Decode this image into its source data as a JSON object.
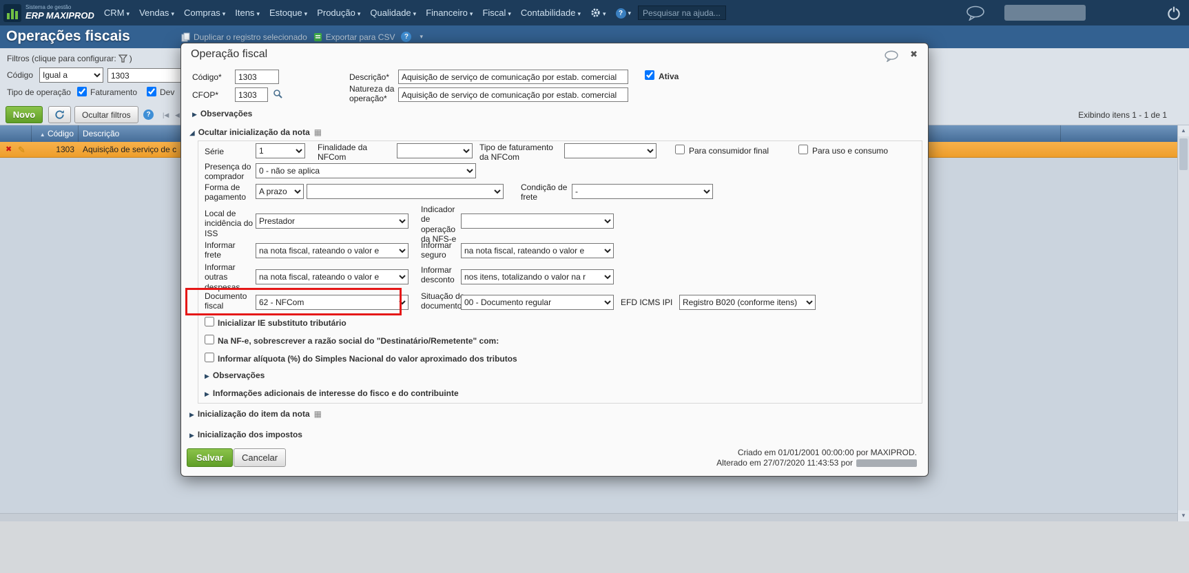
{
  "icons": {
    "caret_down": "▾",
    "collapsed": "▶",
    "expanded": "◢",
    "grid": "▦",
    "close": "✖",
    "delete": "✖",
    "edit": "✎",
    "sort_asc": "▲",
    "scroll_up": "▲",
    "scroll_down": "▼",
    "help": "?",
    "page_first": "|◀",
    "page_prev": "◀"
  },
  "topbar": {
    "brand_top": "Sistema de gestão",
    "brand_main": "ERP MAXIPROD",
    "menus": [
      "CRM",
      "Vendas",
      "Compras",
      "Itens",
      "Estoque",
      "Produção",
      "Qualidade",
      "Financeiro",
      "Fiscal",
      "Contabilidade"
    ],
    "search_placeholder": "Pesquisar na ajuda..."
  },
  "page": {
    "title": "Operações fiscais",
    "toolbar": {
      "duplicate": "Duplicar o registro selecionado",
      "export_csv": "Exportar para CSV"
    },
    "filters": {
      "header": "Filtros (clique para configurar:",
      "header_close": ")",
      "codigo_label": "Código",
      "codigo_operator": "Igual a",
      "codigo_value": "1303",
      "tipo_operacao_label": "Tipo de operação",
      "faturamento_label": "Faturamento",
      "faturamento_checked": true,
      "devolucao_label": "Dev",
      "devolucao_checked": true
    },
    "buttons": {
      "novo": "Novo",
      "ocultar_filtros": "Ocultar filtros"
    },
    "paging_status": "Exibindo itens 1 - 1 de 1",
    "grid": {
      "columns": [
        "Código",
        "Descrição"
      ],
      "rows": [
        {
          "codigo": "1303",
          "descricao": "Aquisição de serviço de c"
        }
      ]
    }
  },
  "modal": {
    "title": "Operação fiscal",
    "codigo": {
      "label": "Código*",
      "value": "1303"
    },
    "descricao": {
      "label": "Descrição*",
      "value": "Aquisição de serviço de comunicação por estab. comercial"
    },
    "ativa": {
      "label": "Ativa",
      "checked": true
    },
    "cfop": {
      "label": "CFOP*",
      "value": "1303"
    },
    "natureza": {
      "label": "Natureza da operação*",
      "value": "Aquisição de serviço de comunicação por estab. comercial"
    },
    "observacoes_top": "Observações",
    "section_nota": "Ocultar inicialização da nota",
    "serie": {
      "label": "Série",
      "value": "1"
    },
    "finalidade_nfcom": {
      "label": "Finalidade da NFCom",
      "value": ""
    },
    "tipo_faturamento_nfcom": {
      "label": "Tipo de faturamento da NFCom",
      "value": ""
    },
    "para_consumidor_final": {
      "label": "Para consumidor final",
      "checked": false
    },
    "para_uso_consumo": {
      "label": "Para uso e consumo",
      "checked": false
    },
    "presenca_comprador": {
      "label": "Presença do comprador",
      "value": "0 - não se aplica"
    },
    "forma_pagamento": {
      "label": "Forma de pagamento",
      "value1": "A prazo",
      "value2": ""
    },
    "condicao_frete": {
      "label": "Condição de frete",
      "value": "-"
    },
    "local_iss": {
      "label": "Local de incidência do ISS",
      "value": "Prestador"
    },
    "indicador_nfse": {
      "label": "Indicador de operação da NFS-e",
      "value": ""
    },
    "informar_frete": {
      "label": "Informar frete",
      "value": "na nota fiscal, rateando o valor e"
    },
    "informar_seguro": {
      "label": "Informar seguro",
      "value": "na nota fiscal, rateando o valor e"
    },
    "informar_outras_despesas": {
      "label": "Informar outras despesas",
      "value": "na nota fiscal, rateando o valor e"
    },
    "informar_desconto": {
      "label": "Informar desconto",
      "value": "nos itens, totalizando o valor na r"
    },
    "documento_fiscal": {
      "label": "Documento fiscal",
      "value": "62 - NFCom"
    },
    "situacao_documento": {
      "label": "Situação do documento",
      "value": "00 - Documento regular"
    },
    "efd_icms_ipi": {
      "label": "EFD ICMS IPI",
      "value": "Registro B020 (conforme itens)"
    },
    "cb_ie": {
      "label": "Inicializar IE substituto tributário",
      "checked": false
    },
    "cb_nfe": {
      "label": "Na NF-e, sobrescrever a razão social do \"Destinatário/Remetente\" com:",
      "checked": false
    },
    "cb_aliquota": {
      "label": "Informar alíquota (%) do Simples Nacional do valor aproximado dos tributos",
      "checked": false
    },
    "observacoes_section": "Observações",
    "info_adicionais": "Informações adicionais de interesse do fisco e do contribuinte",
    "init_item": "Inicialização do item da nota",
    "init_impostos": "Inicialização dos impostos",
    "salvar": "Salvar",
    "cancelar": "Cancelar",
    "criado": "Criado em 01/01/2001 00:00:00 por MAXIPROD.",
    "alterado": "Alterado em 27/07/2020 11:43:53 por"
  }
}
